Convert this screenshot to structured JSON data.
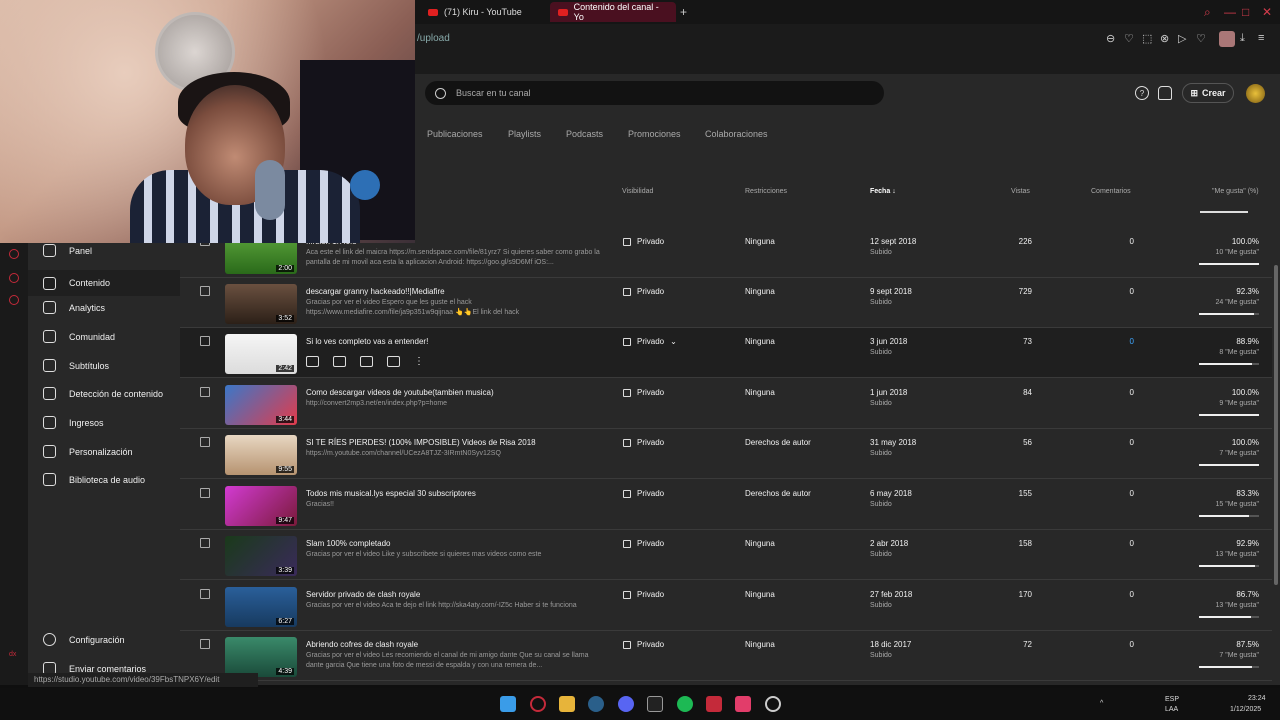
{
  "browser": {
    "tabs": [
      {
        "label": "(71) Kiru - YouTube"
      },
      {
        "label": "Contenido del canal - Yo"
      }
    ],
    "url": "/upload"
  },
  "header": {
    "search_placeholder": "Buscar en tu canal",
    "create_label": "Crear"
  },
  "content_tabs": [
    "Publicaciones",
    "Playlists",
    "Podcasts",
    "Promociones",
    "Colaboraciones"
  ],
  "columns": {
    "visibility": "Visibilidad",
    "restrictions": "Restricciones",
    "date": "Fecha",
    "views": "Vistas",
    "comments": "Comentarios",
    "likes": "\"Me gusta\" (%)"
  },
  "sidebar": {
    "items": [
      {
        "label": "Panel",
        "icon": "dashboard-icon"
      },
      {
        "label": "Contenido",
        "icon": "content-icon"
      },
      {
        "label": "Analytics",
        "icon": "analytics-icon"
      },
      {
        "label": "Comunidad",
        "icon": "community-icon"
      },
      {
        "label": "Subtítulos",
        "icon": "subtitles-icon"
      },
      {
        "label": "Detección de contenido",
        "icon": "copyright-icon"
      },
      {
        "label": "Ingresos",
        "icon": "money-icon"
      },
      {
        "label": "Personalización",
        "icon": "wand-icon"
      },
      {
        "label": "Biblioteca de audio",
        "icon": "audio-library-icon"
      }
    ],
    "settings": "Configuración",
    "feedback": "Enviar comentarios"
  },
  "videos": [
    {
      "title": "...rsion 1.7.0.5",
      "desc": "Aca este el link del maicra https://m.sendspace.com/file/81yrz7 Si quieres saber como grabo la pantalla de mi movil aca esta la aplicacion Android: https://goo.gl/s9D6Mf iOS:...",
      "duration": "2:00",
      "visibility": "Privado",
      "restriction": "Ninguna",
      "date": "12 sept 2018",
      "status": "Subido",
      "views": "226",
      "comments": "0",
      "pct": "100.0%",
      "likes": "10 \"Me gusta\"",
      "ratio": 1.0
    },
    {
      "title": "descargar granny hackeado!!|Mediafire",
      "desc": "Gracias por ver el video Espero que les guste el hack https://www.mediafire.com/file/ja9p351w9qijnaa 👆👆El link del hack",
      "duration": "3:52",
      "visibility": "Privado",
      "restriction": "Ninguna",
      "date": "9 sept 2018",
      "status": "Subido",
      "views": "729",
      "comments": "0",
      "pct": "92.3%",
      "likes": "24 \"Me gusta\"",
      "ratio": 0.923
    },
    {
      "title": "Si lo ves completo vas a entender!",
      "desc": "",
      "duration": "2:42",
      "visibility": "Privado",
      "restriction": "Ninguna",
      "date": "3 jun 2018",
      "status": "Subido",
      "views": "73",
      "comments": "0",
      "pct": "88.9%",
      "likes": "8 \"Me gusta\"",
      "ratio": 0.889
    },
    {
      "title": "Como descargar videos de youtube(tambien musica)",
      "desc": "http://convert2mp3.net/en/index.php?p=home",
      "duration": "3:44",
      "visibility": "Privado",
      "restriction": "Ninguna",
      "date": "1 jun 2018",
      "status": "Subido",
      "views": "84",
      "comments": "0",
      "pct": "100.0%",
      "likes": "9 \"Me gusta\"",
      "ratio": 1.0
    },
    {
      "title": "SI TE RÍES PIERDES! (100% IMPOSIBLE) Videos de Risa 2018",
      "desc": "https://m.youtube.com/channel/UCezA8TJZ-3IRmtN0Syv12SQ",
      "duration": "9:55",
      "visibility": "Privado",
      "restriction": "Derechos de autor",
      "date": "31 may 2018",
      "status": "Subido",
      "views": "56",
      "comments": "0",
      "pct": "100.0%",
      "likes": "7 \"Me gusta\"",
      "ratio": 1.0
    },
    {
      "title": "Todos mis musical.lys especial 30 subscriptores",
      "desc": "Gracias!!",
      "duration": "9:47",
      "visibility": "Privado",
      "restriction": "Derechos de autor",
      "date": "6 may 2018",
      "status": "Subido",
      "views": "155",
      "comments": "0",
      "pct": "83.3%",
      "likes": "15 \"Me gusta\"",
      "ratio": 0.833
    },
    {
      "title": "Slam 100% completado",
      "desc": "Gracias por ver el video Like y subscribete si quieres mas videos como este",
      "duration": "3:39",
      "visibility": "Privado",
      "restriction": "Ninguna",
      "date": "2 abr 2018",
      "status": "Subido",
      "views": "158",
      "comments": "0",
      "pct": "92.9%",
      "likes": "13 \"Me gusta\"",
      "ratio": 0.929
    },
    {
      "title": "Servidor privado de clash royale",
      "desc": "Gracias por ver el video Aca te dejo el link http://ska4aty.com/-IZ5c Haber si te funciona",
      "duration": "6:27",
      "visibility": "Privado",
      "restriction": "Ninguna",
      "date": "27 feb 2018",
      "status": "Subido",
      "views": "170",
      "comments": "0",
      "pct": "86.7%",
      "likes": "13 \"Me gusta\"",
      "ratio": 0.867
    },
    {
      "title": "Abriendo cofres de clash royale",
      "desc": "Gracias por ver el video Les recomiendo el canal de mi amigo dante Que su canal se llama dante garcia Que tiene una foto de messi de espalda y con una remera de...",
      "duration": "4:39",
      "visibility": "Privado",
      "restriction": "Ninguna",
      "date": "18 dic 2017",
      "status": "Subido",
      "views": "72",
      "comments": "0",
      "pct": "87.5%",
      "likes": "7 \"Me gusta\"",
      "ratio": 0.875
    }
  ],
  "status_url": "https://studio.youtube.com/video/39FbsTNPX6Y/edit",
  "taskbar": {
    "lang1": "ESP",
    "lang2": "LAA",
    "time": "23:24",
    "date": "1/12/2025"
  }
}
